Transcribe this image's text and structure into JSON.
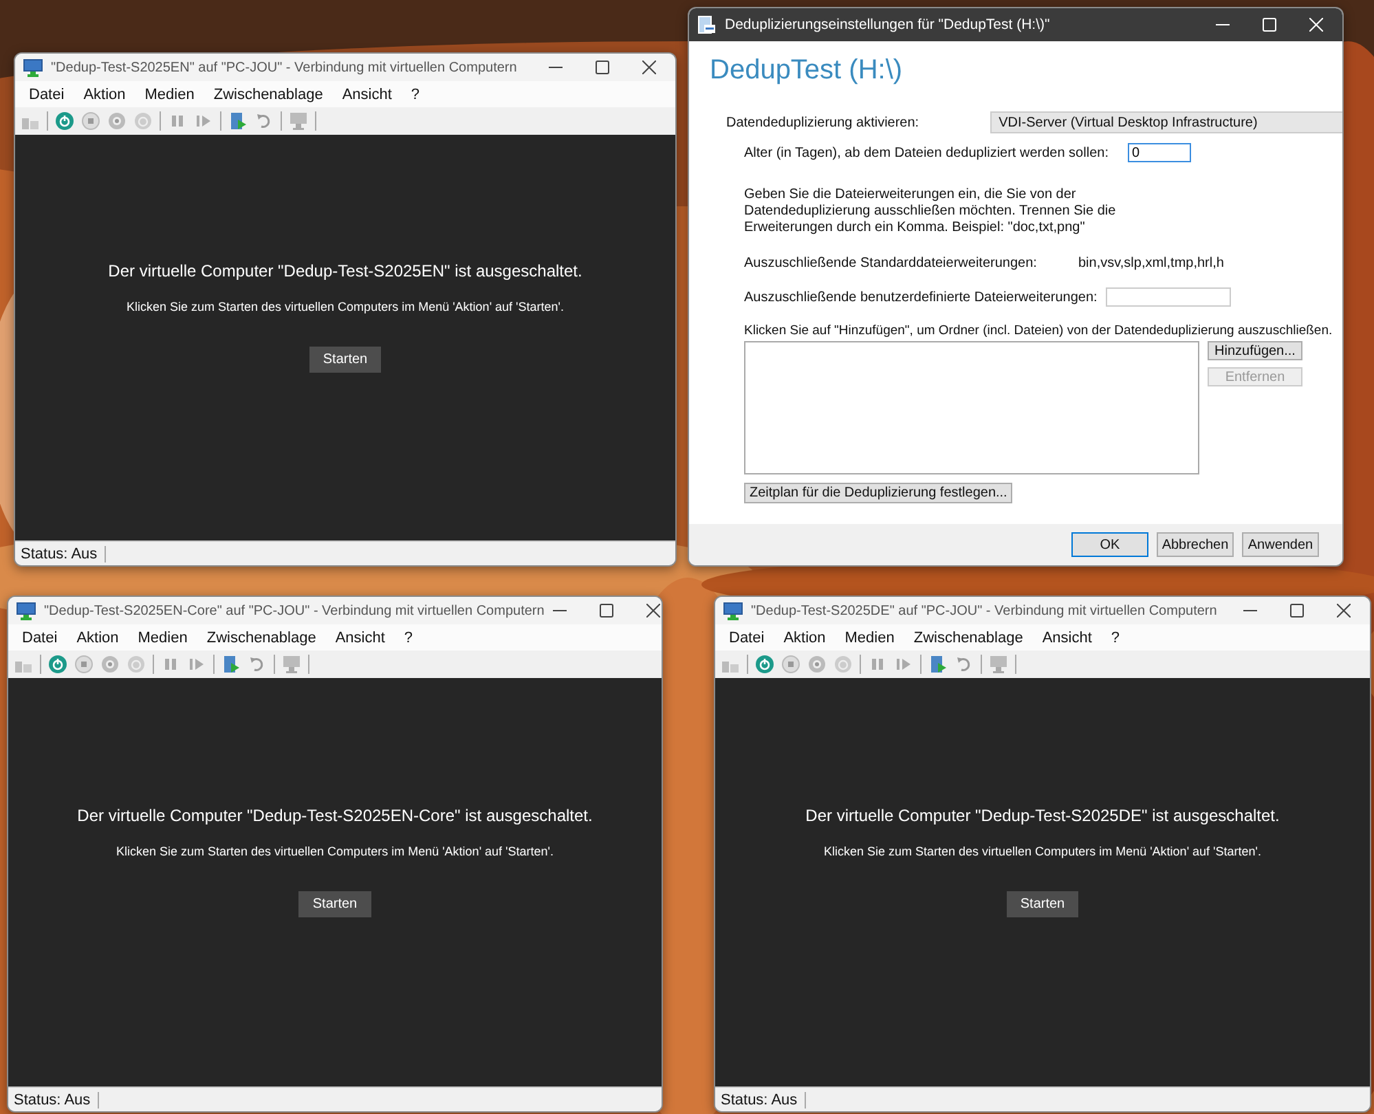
{
  "vm_windows": [
    {
      "title": "\"Dedup-Test-S2025EN\" auf \"PC-JOU\" - Verbindung mit virtuellen Computern",
      "menu": [
        "Datei",
        "Aktion",
        "Medien",
        "Zwischenablage",
        "Ansicht",
        "?"
      ],
      "message": "Der virtuelle Computer \"Dedup-Test-S2025EN\" ist ausgeschaltet.",
      "hint": "Klicken Sie zum Starten des virtuellen Computers im Menü 'Aktion' auf 'Starten'.",
      "start_button": "Starten",
      "status": "Status: Aus"
    },
    {
      "title": "\"Dedup-Test-S2025EN-Core\" auf \"PC-JOU\" - Verbindung mit virtuellen Computern",
      "menu": [
        "Datei",
        "Aktion",
        "Medien",
        "Zwischenablage",
        "Ansicht",
        "?"
      ],
      "message": "Der virtuelle Computer \"Dedup-Test-S2025EN-Core\" ist ausgeschaltet.",
      "hint": "Klicken Sie zum Starten des virtuellen Computers im Menü 'Aktion' auf 'Starten'.",
      "start_button": "Starten",
      "status": "Status: Aus"
    },
    {
      "title": "\"Dedup-Test-S2025DE\" auf \"PC-JOU\" - Verbindung mit virtuellen Computern",
      "menu": [
        "Datei",
        "Aktion",
        "Medien",
        "Zwischenablage",
        "Ansicht",
        "?"
      ],
      "message": "Der virtuelle Computer \"Dedup-Test-S2025DE\" ist ausgeschaltet.",
      "hint": "Klicken Sie zum Starten des virtuellen Computers im Menü 'Aktion' auf 'Starten'.",
      "start_button": "Starten",
      "status": "Status: Aus"
    }
  ],
  "dialog": {
    "title": "Deduplizierungseinstellungen für \"DedupTest (H:\\)\"",
    "heading": "DedupTest (H:\\)",
    "enable_label": "Datendeduplizierung aktivieren:",
    "enable_value": "VDI-Server (Virtual Desktop Infrastructure)",
    "age_label": "Alter (in Tagen), ab dem Dateien dedupliziert werden sollen:",
    "age_value": "0",
    "instructions": "Geben Sie die Dateierweiterungen ein, die Sie von der Datendeduplizierung ausschließen möchten. Trennen Sie die Erweiterungen durch ein Komma. Beispiel: \"doc,txt,png\"",
    "default_ext_label": "Auszuschließende Standarddateierweiterungen:",
    "default_ext_value": "bin,vsv,slp,xml,tmp,hrl,h",
    "custom_ext_label": "Auszuschließende benutzerdefinierte Dateierweiterungen:",
    "folders_hint": "Klicken Sie auf \"Hinzufügen\", um Ordner (incl. Dateien) von der Datendeduplizierung auszuschließen.",
    "side_buttons": [
      {
        "label": "Hinzufügen...",
        "disabled": false
      },
      {
        "label": "Entfernen",
        "disabled": true
      }
    ],
    "schedule_button": "Zeitplan für die Deduplizierung festlegen...",
    "footer_buttons": [
      {
        "label": "OK",
        "default": true
      },
      {
        "label": "Abbrechen",
        "default": false
      },
      {
        "label": "Anwenden",
        "default": false
      }
    ]
  }
}
